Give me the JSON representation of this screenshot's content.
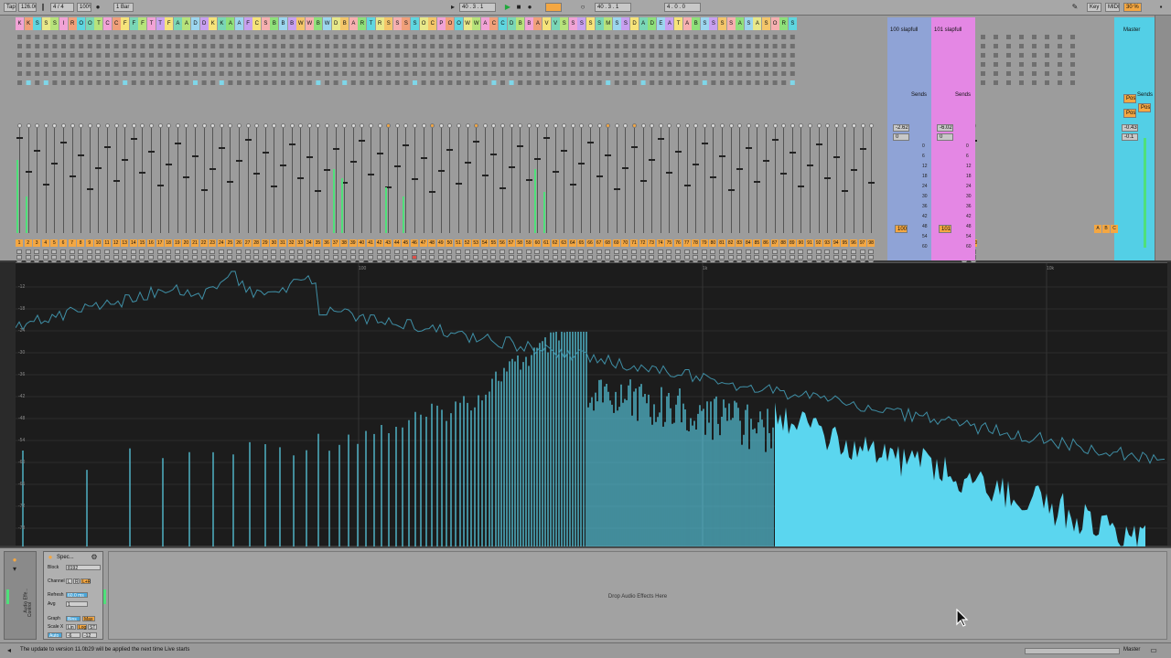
{
  "topbar": {
    "tap_label": "Tap",
    "tempo": "126.00",
    "signature": "4 / 4",
    "zoom": "100%",
    "quantize": "1 Bar",
    "position": "40 . 3 . 1",
    "loop_start": "40 . 3 . 1",
    "loop_length": "4 . 0 . 0",
    "key_label": "Key",
    "midi_label": "MIDI",
    "cpu": "30 %"
  },
  "track_letters": [
    "K",
    "K",
    "S",
    "S",
    "S",
    "I",
    "R",
    "O",
    "O",
    "T",
    "C",
    "C",
    "F",
    "F",
    "F",
    "T",
    "T",
    "F",
    "A",
    "A",
    "D",
    "D",
    "K",
    "K",
    "A",
    "A",
    "F",
    "C",
    "S",
    "B",
    "B",
    "B",
    "W",
    "W",
    "B",
    "W",
    "D",
    "B",
    "A",
    "R",
    "T",
    "R",
    "S",
    "S",
    "S",
    "S",
    "O",
    "C",
    "P",
    "O",
    "O",
    "W",
    "W",
    "A",
    "C",
    "C",
    "D",
    "B",
    "B",
    "A",
    "V",
    "V",
    "S",
    "S",
    "S",
    "S",
    "S",
    "M",
    "S",
    "S",
    "D",
    "A",
    "D",
    "E",
    "A",
    "T",
    "A",
    "B",
    "S",
    "S",
    "S",
    "S",
    "A",
    "S",
    "A",
    "S",
    "O",
    "R",
    "S"
  ],
  "returns": {
    "a_name": "100 slapfull",
    "b_name": "101 slapfull",
    "master_name": "Master",
    "sends_label": "Sends",
    "post_label": "Post"
  },
  "return_values": {
    "a_vol": "-2.62",
    "b_vol": "-6.02",
    "master_vol": "-0.43",
    "a_num": "100",
    "b_num": "101",
    "a_zero": "0",
    "b_zero": "0",
    "master_peak": "-0.1"
  },
  "fader_scale": [
    "0",
    "6",
    "12",
    "18",
    "24",
    "30",
    "36",
    "42",
    "48",
    "54",
    "60"
  ],
  "return_letters": [
    "A",
    "B",
    "C"
  ],
  "spectrum": {
    "db_labels": [
      "-12",
      "-18",
      "-24",
      "-30",
      "-36",
      "-42",
      "-48",
      "-54",
      "-60",
      "-66",
      "-72",
      "-78"
    ],
    "freq_labels": [
      "100",
      "1k",
      "10k"
    ],
    "fill_color": "#5bd6ef",
    "line_color": "#3f8fa6"
  },
  "device": {
    "title": "Spec...",
    "block_label": "Block",
    "block_value": "8192",
    "channel_label": "Channel",
    "channel_options": [
      "L",
      "R",
      "L+R"
    ],
    "refresh_label": "Refresh",
    "refresh_value": "60.0 ms",
    "avg_label": "Avg",
    "avg_value": "1",
    "graph_label": "Graph",
    "graph_options": [
      "Bins",
      "Max"
    ],
    "scalex_label": "Scale X",
    "scalex_options": [
      "Lin",
      "Log",
      "ST"
    ],
    "auto_label": "Auto",
    "auto_values": [
      "-6",
      "-12"
    ],
    "rack_label": "Audio Effe...",
    "controls_label": "Control"
  },
  "drop_zone_text": "Drop Audio Effects Here",
  "status": {
    "message": "The update to version 11.0b29 will be applied the next time Live starts",
    "right_label": "Master"
  }
}
